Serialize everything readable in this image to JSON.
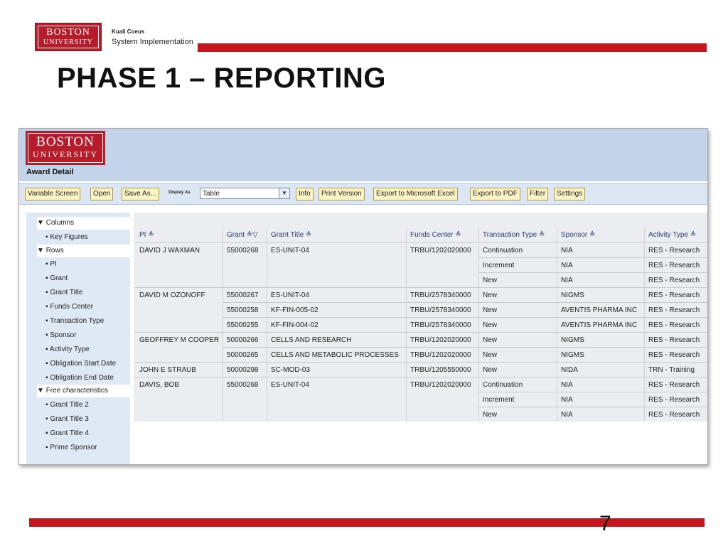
{
  "header": {
    "logo_line1": "BOSTON",
    "logo_line2": "UNIVERSITY",
    "kc_title": "Kuali Coeus",
    "kc_subtitle": "System Implementation",
    "title": "PHASE 1 – REPORTING"
  },
  "app": {
    "logo_line1": "BOSTON",
    "logo_line2": "UNIVERSITY",
    "page_title": "Award Detail"
  },
  "toolbar": {
    "variable_screen": "Variable Screen",
    "open": "Open",
    "save_as": "Save As...",
    "display_as_label": "Display As",
    "display_as_value": "Table",
    "info": "Info",
    "print_version": "Print Version",
    "export_excel": "Export to Microsoft Excel",
    "export_pdf": "Export to PDF",
    "filter": "Filter",
    "settings": "Settings"
  },
  "nav": {
    "columns": "Columns",
    "key_figures": "Key Figures",
    "rows": "Rows",
    "rows_items": [
      "PI",
      "Grant",
      "Grant Title",
      "Funds Center",
      "Transaction Type",
      "Sponsor",
      "Activity Type",
      "Obligation Start Date",
      "Obligation End Date"
    ],
    "free_chars": "Free characteristics",
    "free_items": [
      "Grant Title 2",
      "Grant Title 3",
      "Grant Title 4",
      "Prime Sponsor"
    ]
  },
  "table": {
    "headers": [
      "PI ≜",
      "Grant ≜▽",
      "Grant Title ≜",
      "Funds Center ≜",
      "Transaction Type ≜",
      "Sponsor ≜",
      "Activity Type ≜"
    ],
    "rows": [
      [
        "DAVID J WAXMAN",
        "55000268",
        "ES-UNIT-04",
        "TRBU/1202020000",
        "Continuation",
        "NIA",
        "RES - Research"
      ],
      [
        "",
        "",
        "",
        "",
        "Increment",
        "NIA",
        "RES - Research"
      ],
      [
        "",
        "",
        "",
        "",
        "New",
        "NIA",
        "RES - Research"
      ],
      [
        "DAVID M OZONOFF",
        "55000267",
        "ES-UNIT-04",
        "TRBU/2578340000",
        "New",
        "NIGMS",
        "RES - Research"
      ],
      [
        "",
        "55000258",
        "KF-FIN-005-02",
        "TRBU/2578340000",
        "New",
        "AVENTIS PHARMA INC",
        "RES - Research"
      ],
      [
        "",
        "55000255",
        "KF-FIN-004-02",
        "TRBU/2578340000",
        "New",
        "AVENTIS PHARMA INC",
        "RES - Research"
      ],
      [
        "GEOFFREY M COOPER",
        "50000266",
        "CELLS AND RESEARCH",
        "TRBU/1202020000",
        "New",
        "NIGMS",
        "RES - Research"
      ],
      [
        "",
        "50000265",
        "CELLS AND METABOLIC PROCESSES",
        "TRBU/1202020000",
        "New",
        "NIGMS",
        "RES - Research"
      ],
      [
        "JOHN E STRAUB",
        "50000298",
        "SC-MOD-03",
        "TRBU/1205550000",
        "New",
        "NIDA",
        "TRN - Training"
      ],
      [
        "DAVIS, BOB",
        "55000268",
        "ES-UNIT-04",
        "TRBU/1202020000",
        "Continuation",
        "NIA",
        "RES - Research"
      ],
      [
        "",
        "",
        "",
        "",
        "Increment",
        "NIA",
        "RES - Research"
      ],
      [
        "",
        "",
        "",
        "",
        "New",
        "NIA",
        "RES - Research"
      ]
    ]
  },
  "footer": {
    "page_number": "7"
  },
  "colors": {
    "accent_red": "#c4161c",
    "header_blue": "#c3d4ea",
    "nav_blue": "#dfe8f5",
    "button_yellow": "#fdf4c6"
  }
}
